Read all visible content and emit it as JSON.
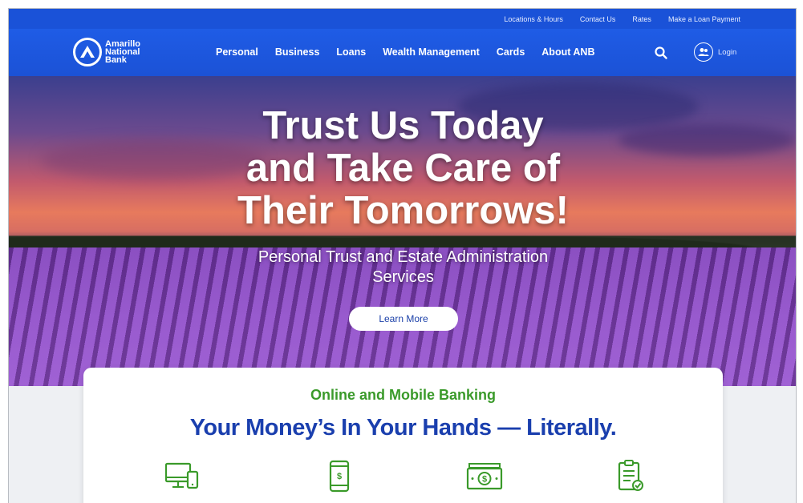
{
  "utility_nav": {
    "items": [
      "Locations & Hours",
      "Contact Us",
      "Rates",
      "Make a Loan Payment"
    ]
  },
  "header": {
    "logo_lines": [
      "Amarillo",
      "National",
      "Bank"
    ],
    "nav": [
      "Personal",
      "Business",
      "Loans",
      "Wealth Management",
      "Cards",
      "About ANB"
    ],
    "search_icon": "search-icon",
    "login_label": "Login",
    "login_icon": "users-icon"
  },
  "hero": {
    "title_lines": [
      "Trust Us Today",
      "and Take Care of",
      "Their Tomorrows!"
    ],
    "subtitle_lines": [
      "Personal Trust and Estate Administration",
      "Services"
    ],
    "cta_label": "Learn More"
  },
  "feature_section": {
    "eyebrow": "Online and Mobile Banking",
    "headline": "Your Money’s In Your Hands — Literally.",
    "icons": [
      "desktop-and-phone-icon",
      "mobile-dollar-icon",
      "cash-bill-icon",
      "checklist-icon"
    ]
  },
  "colors": {
    "brand_blue": "#1b52d6",
    "utility_blue": "#1a52d8",
    "headline_blue": "#1a3fae",
    "accent_green": "#3a9a2a",
    "white": "#ffffff"
  }
}
